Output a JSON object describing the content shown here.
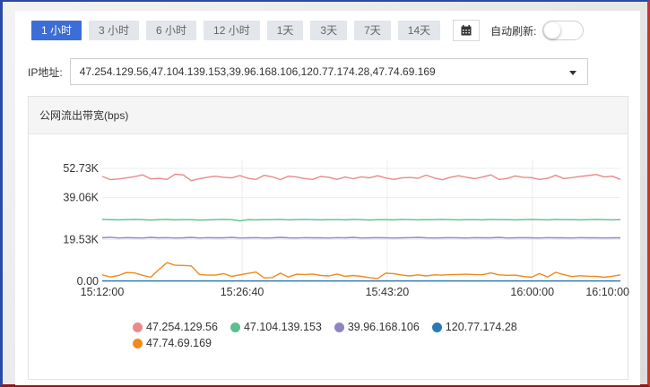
{
  "toolbar": {
    "ranges": [
      "1 小时",
      "3 小时",
      "6 小时",
      "12 小时",
      "1天",
      "3天",
      "7天",
      "14天"
    ],
    "active_index": 0,
    "calendar_icon": "calendar-icon",
    "auto_refresh_label": "自动刷新:",
    "auto_refresh_on": false
  },
  "ip_filter": {
    "label": "IP地址:",
    "value": "47.254.129.56,47.104.139.153,39.96.168.106,120.77.174.28,47.74.69.169"
  },
  "card": {
    "title": "公网流出带宽(bps)"
  },
  "colors": {
    "accent": "#3d6dd6",
    "series": [
      "#e88a8a",
      "#5bbf8e",
      "#8f84c2",
      "#2a78b5",
      "#f08a1e"
    ]
  },
  "chart_data": {
    "type": "line",
    "ylim": [
      0,
      52730
    ],
    "y_ticks": [
      0,
      19530,
      39060,
      52730
    ],
    "y_tick_labels": [
      "0.00",
      "19.53K",
      "39.06K",
      "52.73K"
    ],
    "x_tick_labels": [
      "15:12:00",
      "15:26:40",
      "15:43:20",
      "16:00:00",
      "16:10:00"
    ],
    "x_tick_positions": [
      0,
      0.27,
      0.55,
      0.83,
      1.0
    ],
    "legend_position": "bottom",
    "series": [
      {
        "name": "47.254.129.56",
        "values": [
          49000,
          47500,
          47800,
          48300,
          48900,
          49700,
          47800,
          48100,
          47600,
          50000,
          49700,
          47000,
          47900,
          48600,
          49100,
          48600,
          48300,
          49400,
          48100,
          47600,
          49500,
          48800,
          47500,
          49100,
          48700,
          48000,
          47600,
          49000,
          48600,
          47600,
          48700,
          47900,
          48800,
          48300,
          49300,
          48300,
          47600,
          48300,
          48500,
          48100,
          49600,
          48300,
          47400,
          48600,
          49300,
          48600,
          47900,
          48700,
          49700,
          47600,
          48000,
          49200,
          48600,
          48400,
          47600,
          48100,
          49500,
          48000,
          48400,
          49000,
          49400,
          49900,
          48800,
          49100,
          47600
        ]
      },
      {
        "name": "47.104.139.153",
        "values": [
          28900,
          28800,
          28700,
          28800,
          28900,
          28800,
          28600,
          28800,
          28900,
          28700,
          28800,
          28800,
          28600,
          28700,
          28800,
          28900,
          28800,
          28200,
          28800,
          28700,
          28800,
          28800,
          28900,
          28700,
          28800,
          28900,
          28800,
          28700,
          28800,
          28800,
          28700,
          28900,
          28800,
          28600,
          28800,
          28800,
          28700,
          28900,
          28800,
          28700,
          28800,
          28800,
          28900,
          28800,
          28700,
          28800,
          28800,
          28700,
          28900,
          28800,
          28800,
          28700,
          28800,
          28900,
          28800,
          28700,
          28900,
          28800,
          28800,
          28700,
          28800,
          28900,
          28800,
          28700,
          28800
        ]
      },
      {
        "name": "39.96.168.106",
        "values": [
          20300,
          20600,
          20200,
          20400,
          20300,
          20200,
          20500,
          20300,
          20400,
          20200,
          20300,
          20500,
          20200,
          20400,
          20300,
          20300,
          20500,
          20200,
          20300,
          20400,
          20200,
          20300,
          20500,
          20300,
          20200,
          20400,
          20300,
          20300,
          20200,
          20400,
          20300,
          20500,
          20200,
          20300,
          20400,
          20300,
          20200,
          20300,
          20400,
          20500,
          20300,
          20200,
          20300,
          20400,
          20300,
          20200,
          20400,
          20300,
          20300,
          20500,
          20200,
          20300,
          20400,
          20300,
          20200,
          20400,
          20300,
          20300,
          20200,
          20400,
          20300,
          20300,
          20200,
          20300,
          20300
        ]
      },
      {
        "name": "120.77.174.28",
        "values": [
          150,
          150,
          150,
          150,
          150,
          150,
          150,
          150,
          150,
          150,
          150,
          150,
          150,
          150,
          150,
          150,
          150,
          150,
          150,
          150,
          150,
          150,
          150,
          150,
          150,
          150,
          150,
          150,
          150,
          150,
          150,
          150,
          150,
          150,
          150,
          150,
          150,
          150,
          150,
          150,
          150,
          150,
          150,
          150,
          150,
          150,
          150,
          150,
          150,
          150,
          150,
          150,
          150,
          150,
          150,
          150,
          150,
          150,
          150,
          150,
          150,
          150,
          150,
          150,
          150
        ]
      },
      {
        "name": "47.74.69.169",
        "values": [
          3000,
          2000,
          2700,
          4100,
          3900,
          2800,
          1900,
          5500,
          8700,
          7500,
          7400,
          7200,
          3200,
          2900,
          2900,
          3600,
          2300,
          3000,
          3700,
          4300,
          1600,
          1700,
          3800,
          2000,
          3300,
          3200,
          3400,
          2700,
          2500,
          3400,
          2300,
          2700,
          2300,
          1700,
          1300,
          3800,
          3600,
          2900,
          2500,
          3000,
          2500,
          3000,
          2900,
          3100,
          3200,
          3300,
          3100,
          3100,
          3900,
          3000,
          2800,
          2900,
          2300,
          1900,
          3600,
          2000,
          4200,
          3100,
          2200,
          2600,
          2400,
          2300,
          1900,
          2400,
          3000
        ]
      }
    ]
  }
}
